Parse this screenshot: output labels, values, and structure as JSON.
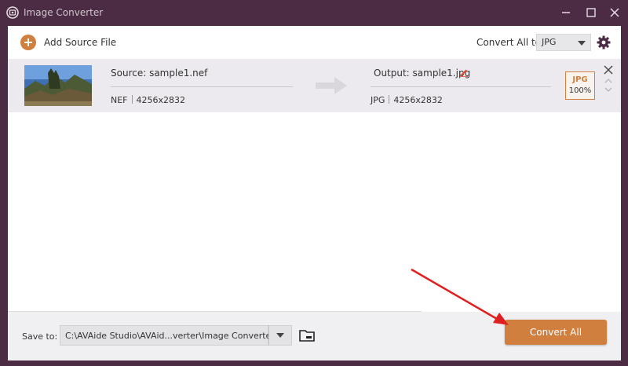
{
  "window": {
    "title": "Image Converter"
  },
  "toolbar": {
    "add_source_label": "Add Source File",
    "convert_all_to_label": "Convert All to:",
    "convert_all_to_value": "JPG"
  },
  "file": {
    "source_label": "Source: sample1.nef",
    "source_format": "NEF",
    "source_resolution": "4256x2832",
    "output_label": "Output: sample1.jpg",
    "output_format": "JPG",
    "output_resolution": "4256x2832",
    "badge_format": "JPG",
    "badge_quality": "100%"
  },
  "footer": {
    "save_to_label": "Save to:",
    "save_path": "C:\\AVAide Studio\\AVAid...verter\\Image Converter",
    "convert_all_button": "Convert All"
  },
  "colors": {
    "accent": "#d07f3e",
    "titlebar": "#4b2c44",
    "annotation_arrow": "#e02020"
  },
  "icons": [
    "app-logo-icon",
    "minimize-icon",
    "maximize-icon",
    "close-icon",
    "plus-icon",
    "gear-icon",
    "arrow-right-icon",
    "edit-pencil-icon",
    "close-icon",
    "chevron-up-icon",
    "chevron-down-icon",
    "folder-icon"
  ]
}
